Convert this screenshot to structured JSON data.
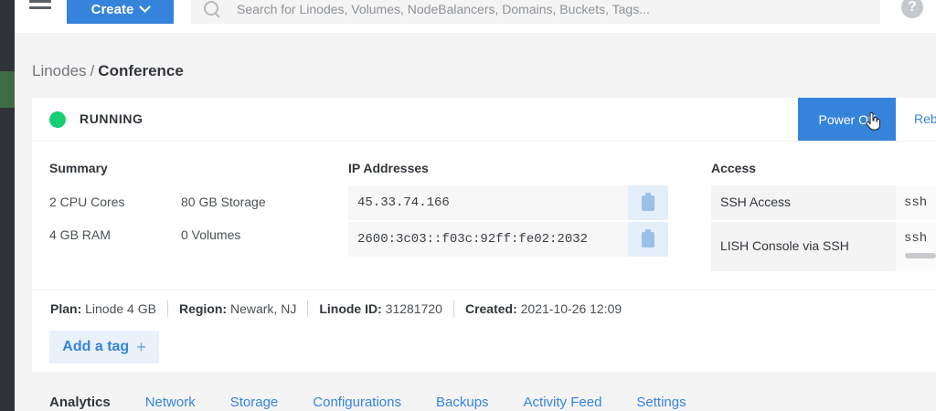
{
  "topbar": {
    "create_label": "Create",
    "search_placeholder": "Search for Linodes, Volumes, NodeBalancers, Domains, Buckets, Tags...",
    "help_label": "?"
  },
  "breadcrumb": {
    "parent": "Linodes",
    "separator": "/",
    "current": "Conference"
  },
  "status": {
    "text": "RUNNING",
    "color": "#17cf73"
  },
  "actions": {
    "power_off": "Power Off",
    "reboot": "Reb"
  },
  "summary": {
    "title": "Summary",
    "cpu": "2 CPU Cores",
    "storage": "80 GB Storage",
    "ram": "4 GB RAM",
    "volumes": "0 Volumes"
  },
  "ip": {
    "title": "IP Addresses",
    "addresses": [
      "45.33.74.166",
      "2600:3c03::f03c:92ff:fe02:2032"
    ]
  },
  "access": {
    "title": "Access",
    "rows": [
      {
        "label": "SSH Access",
        "value": "ssh"
      },
      {
        "label": "LISH Console via SSH",
        "value": "ssh"
      }
    ]
  },
  "meta": {
    "plan_label": "Plan:",
    "plan": "Linode 4 GB",
    "region_label": "Region:",
    "region": "Newark, NJ",
    "id_label": "Linode ID:",
    "id": "31281720",
    "created_label": "Created:",
    "created": "2021-10-26 12:09"
  },
  "tag": {
    "label": "Add a tag",
    "plus": "+"
  },
  "tabs": [
    "Analytics",
    "Network",
    "Storage",
    "Configurations",
    "Backups",
    "Activity Feed",
    "Settings"
  ],
  "colors": {
    "accent": "#3683dc",
    "running": "#17cf73"
  }
}
